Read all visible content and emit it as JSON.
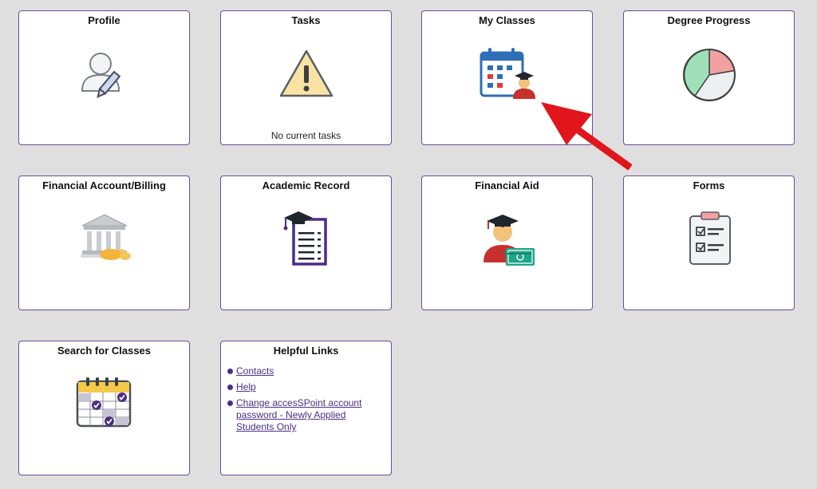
{
  "tiles": {
    "profile": {
      "title": "Profile",
      "icon": "user-edit-icon"
    },
    "tasks": {
      "title": "Tasks",
      "icon": "warning-icon",
      "note": "No current tasks"
    },
    "my_classes": {
      "title": "My Classes",
      "icon": "class-calendar-icon"
    },
    "degree_progress": {
      "title": "Degree Progress",
      "icon": "pie-chart-icon"
    },
    "financial_account": {
      "title": "Financial Account/Billing",
      "icon": "bank-icon"
    },
    "academic_record": {
      "title": "Academic Record",
      "icon": "transcript-icon"
    },
    "financial_aid": {
      "title": "Financial Aid",
      "icon": "graduate-money-icon"
    },
    "forms": {
      "title": "Forms",
      "icon": "clipboard-icon"
    },
    "search_classes": {
      "title": "Search for Classes",
      "icon": "calendar-check-icon"
    },
    "helpful_links": {
      "title": "Helpful Links",
      "links": [
        {
          "label": "Contacts"
        },
        {
          "label": "Help"
        },
        {
          "label": "Change accesSPoint account password - Newly Applied Students Only"
        }
      ]
    }
  },
  "colors": {
    "tile_border": "#6a4c93",
    "link": "#4b2e83",
    "arrow": "#e0161c",
    "background": "#dfdfdf"
  }
}
